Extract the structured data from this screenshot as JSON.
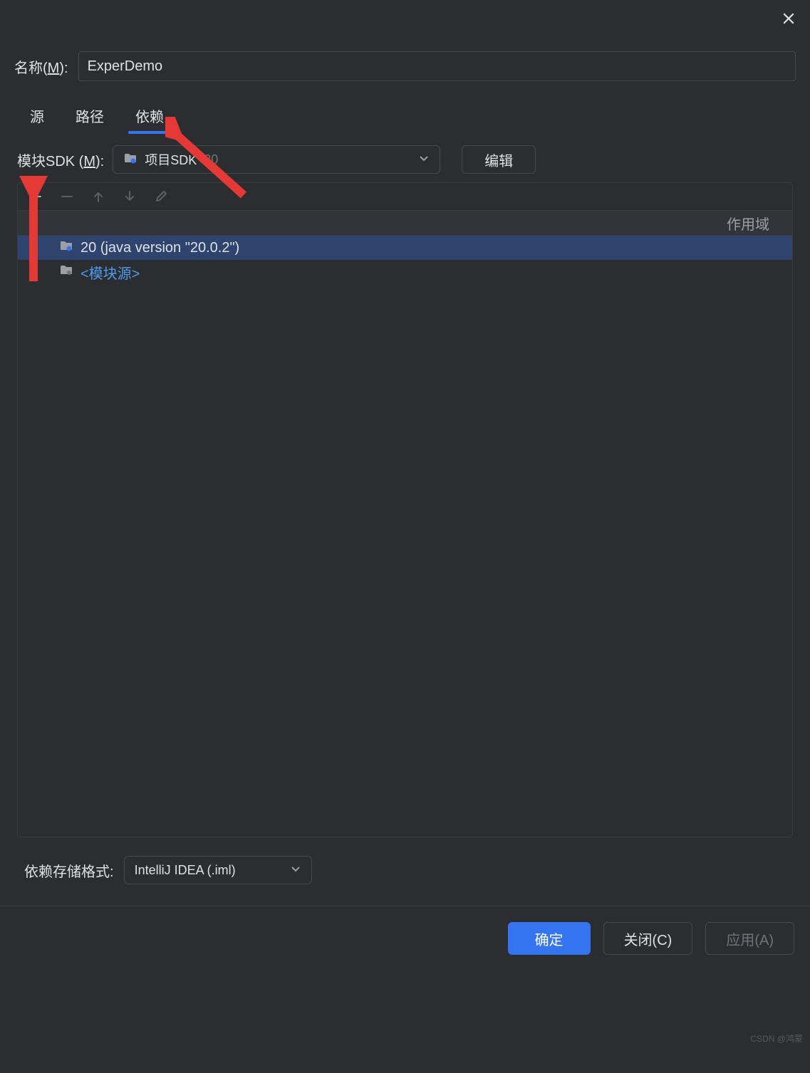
{
  "titlebar": {
    "close": "×"
  },
  "name": {
    "label_pre": "名称(",
    "mnemonic": "M",
    "label_post": "):",
    "value": "ExperDemo"
  },
  "tabs": [
    {
      "id": "sources",
      "label": "源"
    },
    {
      "id": "paths",
      "label": "路径"
    },
    {
      "id": "deps",
      "label": "依赖",
      "active": true
    }
  ],
  "sdk": {
    "label_pre": "模块SDK (",
    "mnemonic": "M",
    "label_post": "):",
    "text1": "项目SDK",
    "text2": "20",
    "edit": "编辑"
  },
  "table": {
    "scope_header": "作用域",
    "rows": [
      {
        "icon": "folder-blue",
        "text": "20 (java version \"20.0.2\")",
        "selected": true,
        "link": false
      },
      {
        "icon": "folder-gray",
        "text": "<模块源>",
        "selected": false,
        "link": true
      }
    ]
  },
  "storage": {
    "label": "依赖存储格式:",
    "value": "IntelliJ IDEA (.iml)"
  },
  "footer": {
    "ok": "确定",
    "close": "关闭(C)",
    "apply": "应用(A)"
  },
  "watermark": "CSDN @鸿蒙"
}
